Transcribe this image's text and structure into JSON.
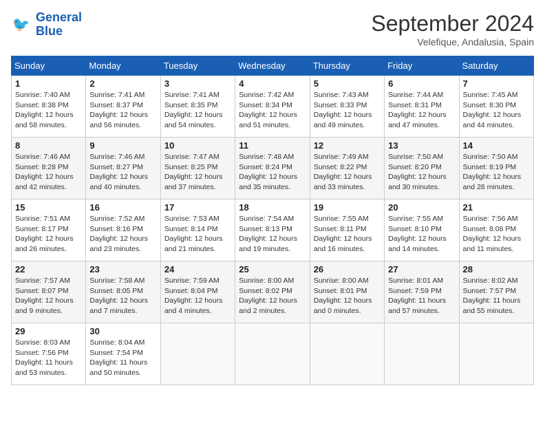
{
  "logo": {
    "line1": "General",
    "line2": "Blue"
  },
  "title": "September 2024",
  "location": "Velefique, Andalusia, Spain",
  "weekdays": [
    "Sunday",
    "Monday",
    "Tuesday",
    "Wednesday",
    "Thursday",
    "Friday",
    "Saturday"
  ],
  "days": [
    {
      "num": "",
      "info": ""
    },
    {
      "num": "2",
      "info": "Sunrise: 7:41 AM\nSunset: 8:37 PM\nDaylight: 12 hours\nand 56 minutes."
    },
    {
      "num": "3",
      "info": "Sunrise: 7:41 AM\nSunset: 8:35 PM\nDaylight: 12 hours\nand 54 minutes."
    },
    {
      "num": "4",
      "info": "Sunrise: 7:42 AM\nSunset: 8:34 PM\nDaylight: 12 hours\nand 51 minutes."
    },
    {
      "num": "5",
      "info": "Sunrise: 7:43 AM\nSunset: 8:33 PM\nDaylight: 12 hours\nand 49 minutes."
    },
    {
      "num": "6",
      "info": "Sunrise: 7:44 AM\nSunset: 8:31 PM\nDaylight: 12 hours\nand 47 minutes."
    },
    {
      "num": "7",
      "info": "Sunrise: 7:45 AM\nSunset: 8:30 PM\nDaylight: 12 hours\nand 44 minutes."
    },
    {
      "num": "8",
      "info": "Sunrise: 7:46 AM\nSunset: 8:28 PM\nDaylight: 12 hours\nand 42 minutes."
    },
    {
      "num": "9",
      "info": "Sunrise: 7:46 AM\nSunset: 8:27 PM\nDaylight: 12 hours\nand 40 minutes."
    },
    {
      "num": "10",
      "info": "Sunrise: 7:47 AM\nSunset: 8:25 PM\nDaylight: 12 hours\nand 37 minutes."
    },
    {
      "num": "11",
      "info": "Sunrise: 7:48 AM\nSunset: 8:24 PM\nDaylight: 12 hours\nand 35 minutes."
    },
    {
      "num": "12",
      "info": "Sunrise: 7:49 AM\nSunset: 8:22 PM\nDaylight: 12 hours\nand 33 minutes."
    },
    {
      "num": "13",
      "info": "Sunrise: 7:50 AM\nSunset: 8:20 PM\nDaylight: 12 hours\nand 30 minutes."
    },
    {
      "num": "14",
      "info": "Sunrise: 7:50 AM\nSunset: 8:19 PM\nDaylight: 12 hours\nand 28 minutes."
    },
    {
      "num": "15",
      "info": "Sunrise: 7:51 AM\nSunset: 8:17 PM\nDaylight: 12 hours\nand 26 minutes."
    },
    {
      "num": "16",
      "info": "Sunrise: 7:52 AM\nSunset: 8:16 PM\nDaylight: 12 hours\nand 23 minutes."
    },
    {
      "num": "17",
      "info": "Sunrise: 7:53 AM\nSunset: 8:14 PM\nDaylight: 12 hours\nand 21 minutes."
    },
    {
      "num": "18",
      "info": "Sunrise: 7:54 AM\nSunset: 8:13 PM\nDaylight: 12 hours\nand 19 minutes."
    },
    {
      "num": "19",
      "info": "Sunrise: 7:55 AM\nSunset: 8:11 PM\nDaylight: 12 hours\nand 16 minutes."
    },
    {
      "num": "20",
      "info": "Sunrise: 7:55 AM\nSunset: 8:10 PM\nDaylight: 12 hours\nand 14 minutes."
    },
    {
      "num": "21",
      "info": "Sunrise: 7:56 AM\nSunset: 8:08 PM\nDaylight: 12 hours\nand 11 minutes."
    },
    {
      "num": "22",
      "info": "Sunrise: 7:57 AM\nSunset: 8:07 PM\nDaylight: 12 hours\nand 9 minutes."
    },
    {
      "num": "23",
      "info": "Sunrise: 7:58 AM\nSunset: 8:05 PM\nDaylight: 12 hours\nand 7 minutes."
    },
    {
      "num": "24",
      "info": "Sunrise: 7:59 AM\nSunset: 8:04 PM\nDaylight: 12 hours\nand 4 minutes."
    },
    {
      "num": "25",
      "info": "Sunrise: 8:00 AM\nSunset: 8:02 PM\nDaylight: 12 hours\nand 2 minutes."
    },
    {
      "num": "26",
      "info": "Sunrise: 8:00 AM\nSunset: 8:01 PM\nDaylight: 12 hours\nand 0 minutes."
    },
    {
      "num": "27",
      "info": "Sunrise: 8:01 AM\nSunset: 7:59 PM\nDaylight: 11 hours\nand 57 minutes."
    },
    {
      "num": "28",
      "info": "Sunrise: 8:02 AM\nSunset: 7:57 PM\nDaylight: 11 hours\nand 55 minutes."
    },
    {
      "num": "29",
      "info": "Sunrise: 8:03 AM\nSunset: 7:56 PM\nDaylight: 11 hours\nand 53 minutes."
    },
    {
      "num": "30",
      "info": "Sunrise: 8:04 AM\nSunset: 7:54 PM\nDaylight: 11 hours\nand 50 minutes."
    },
    {
      "num": "",
      "info": ""
    },
    {
      "num": "",
      "info": ""
    },
    {
      "num": "",
      "info": ""
    },
    {
      "num": "",
      "info": ""
    },
    {
      "num": "",
      "info": ""
    }
  ],
  "day1": {
    "num": "1",
    "info": "Sunrise: 7:40 AM\nSunset: 8:38 PM\nDaylight: 12 hours\nand 58 minutes."
  }
}
